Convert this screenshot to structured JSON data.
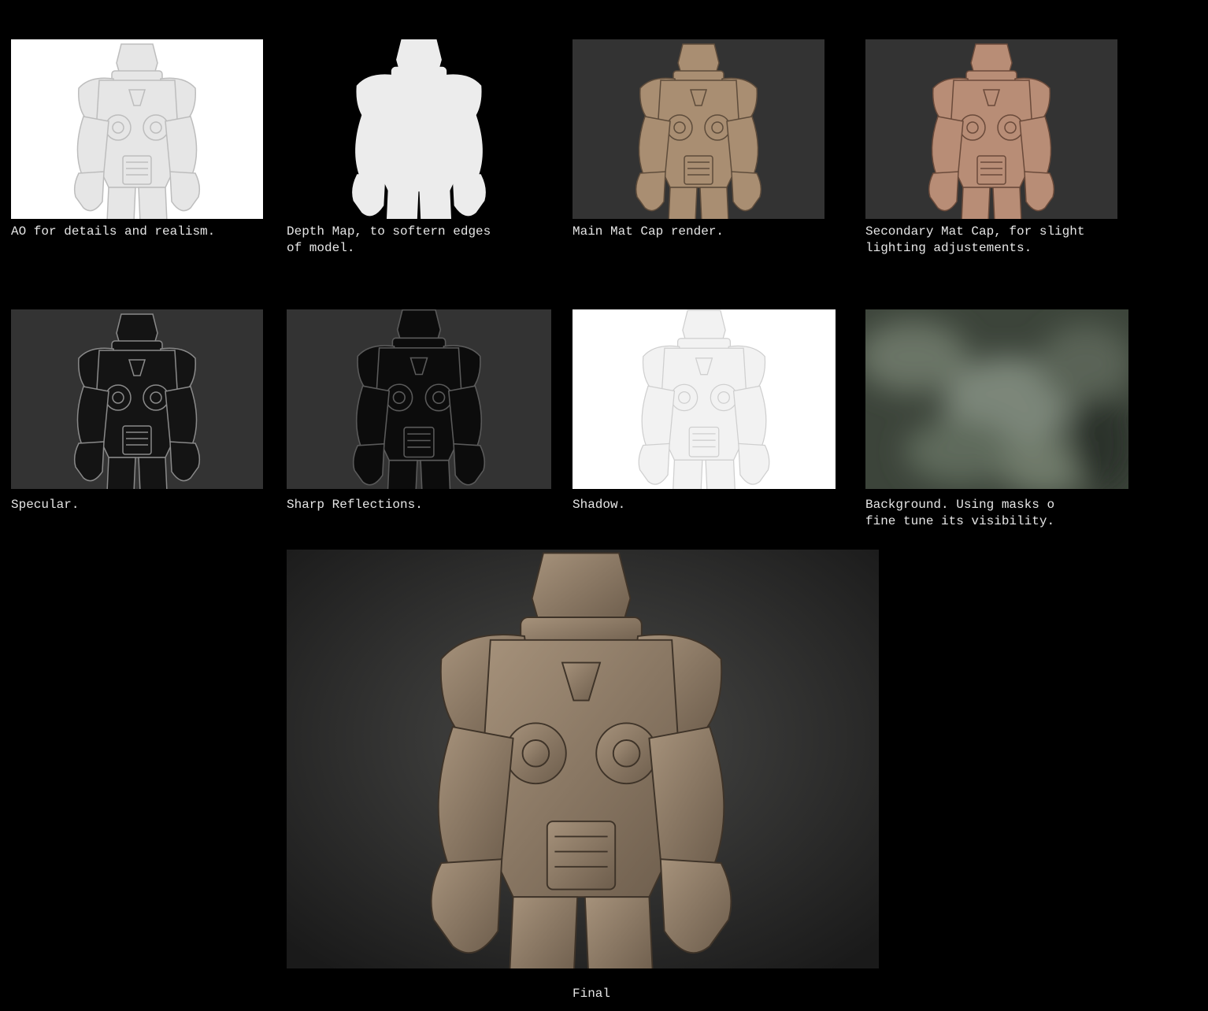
{
  "panels": [
    {
      "caption": "AO for details and realism."
    },
    {
      "caption": "Depth Map, to softern edges\nof model."
    },
    {
      "caption": "Main Mat Cap render."
    },
    {
      "caption": "Secondary Mat Cap, for slight\nlighting adjustements."
    },
    {
      "caption": "Specular."
    },
    {
      "caption": "Sharp Reflections."
    },
    {
      "caption": "Shadow."
    },
    {
      "caption": "Background. Using masks o\nfine tune its visibility."
    }
  ],
  "final": {
    "caption": "Final"
  },
  "colors": {
    "page_background": "#000000",
    "ao_bg": "#ffffff",
    "ao_fill": "#e8e8e8",
    "depth_bg": "#000000",
    "depth_fill": "#ececec",
    "matcap_bg": "#333333",
    "matcap_fill": "#a98e72",
    "matcap2_bg": "#333333",
    "matcap2_fill": "#b88d76",
    "spec_bg": "#333333",
    "spec_fill": "#141414",
    "refl_bg": "#333333",
    "refl_fill": "#0c0c0c",
    "shadow_bg": "#ffffff",
    "shadow_fill": "#eeeeee",
    "final_bg": "#2b2b2b",
    "final_fill": "#8c7a66"
  }
}
